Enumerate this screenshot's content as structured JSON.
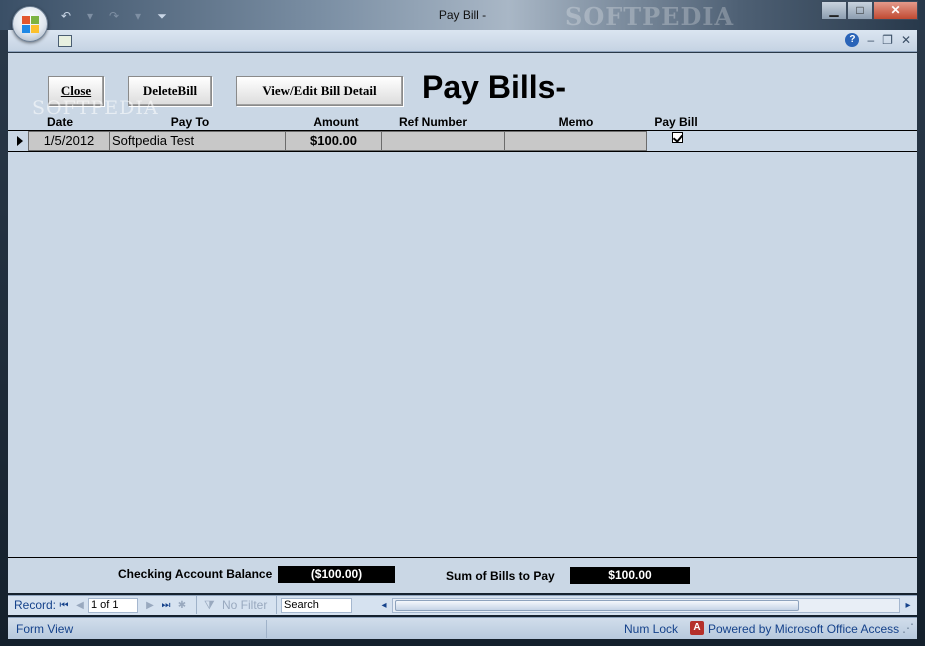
{
  "window": {
    "title": "Pay Bill -",
    "watermark": "SOFTPEDIA"
  },
  "toolbar": {
    "close_label": "Close",
    "delete_label": "DeleteBill",
    "view_edit_label": "View/Edit Bill Detail"
  },
  "form": {
    "title": "Pay Bills-",
    "watermark": "SOFTPEDIA",
    "columns": {
      "date": "Date",
      "pay_to": "Pay To",
      "amount": "Amount",
      "ref_number": "Ref Number",
      "memo": "Memo",
      "pay_bill": "Pay Bill"
    },
    "rows": [
      {
        "date": "1/5/2012",
        "pay_to": "Softpedia Test",
        "amount": "$100.00",
        "ref_number": "",
        "memo": "",
        "pay_bill": true
      }
    ],
    "footer": {
      "balance_label": "Checking Account Balance",
      "balance_value": "($100.00)",
      "sum_label": "Sum of Bills to Pay",
      "sum_value": "$100.00"
    }
  },
  "navigation": {
    "record_label": "Record:",
    "record_position": "1 of 1",
    "filter_label": "No Filter",
    "search_placeholder": "Search"
  },
  "status": {
    "view_label": "Form View",
    "num_lock": "Num Lock",
    "powered_by": "Powered by Microsoft Office Access"
  },
  "colors": {
    "form_background": "#cad7e5",
    "value_box": "#000000",
    "nav_text": "#15428b"
  }
}
